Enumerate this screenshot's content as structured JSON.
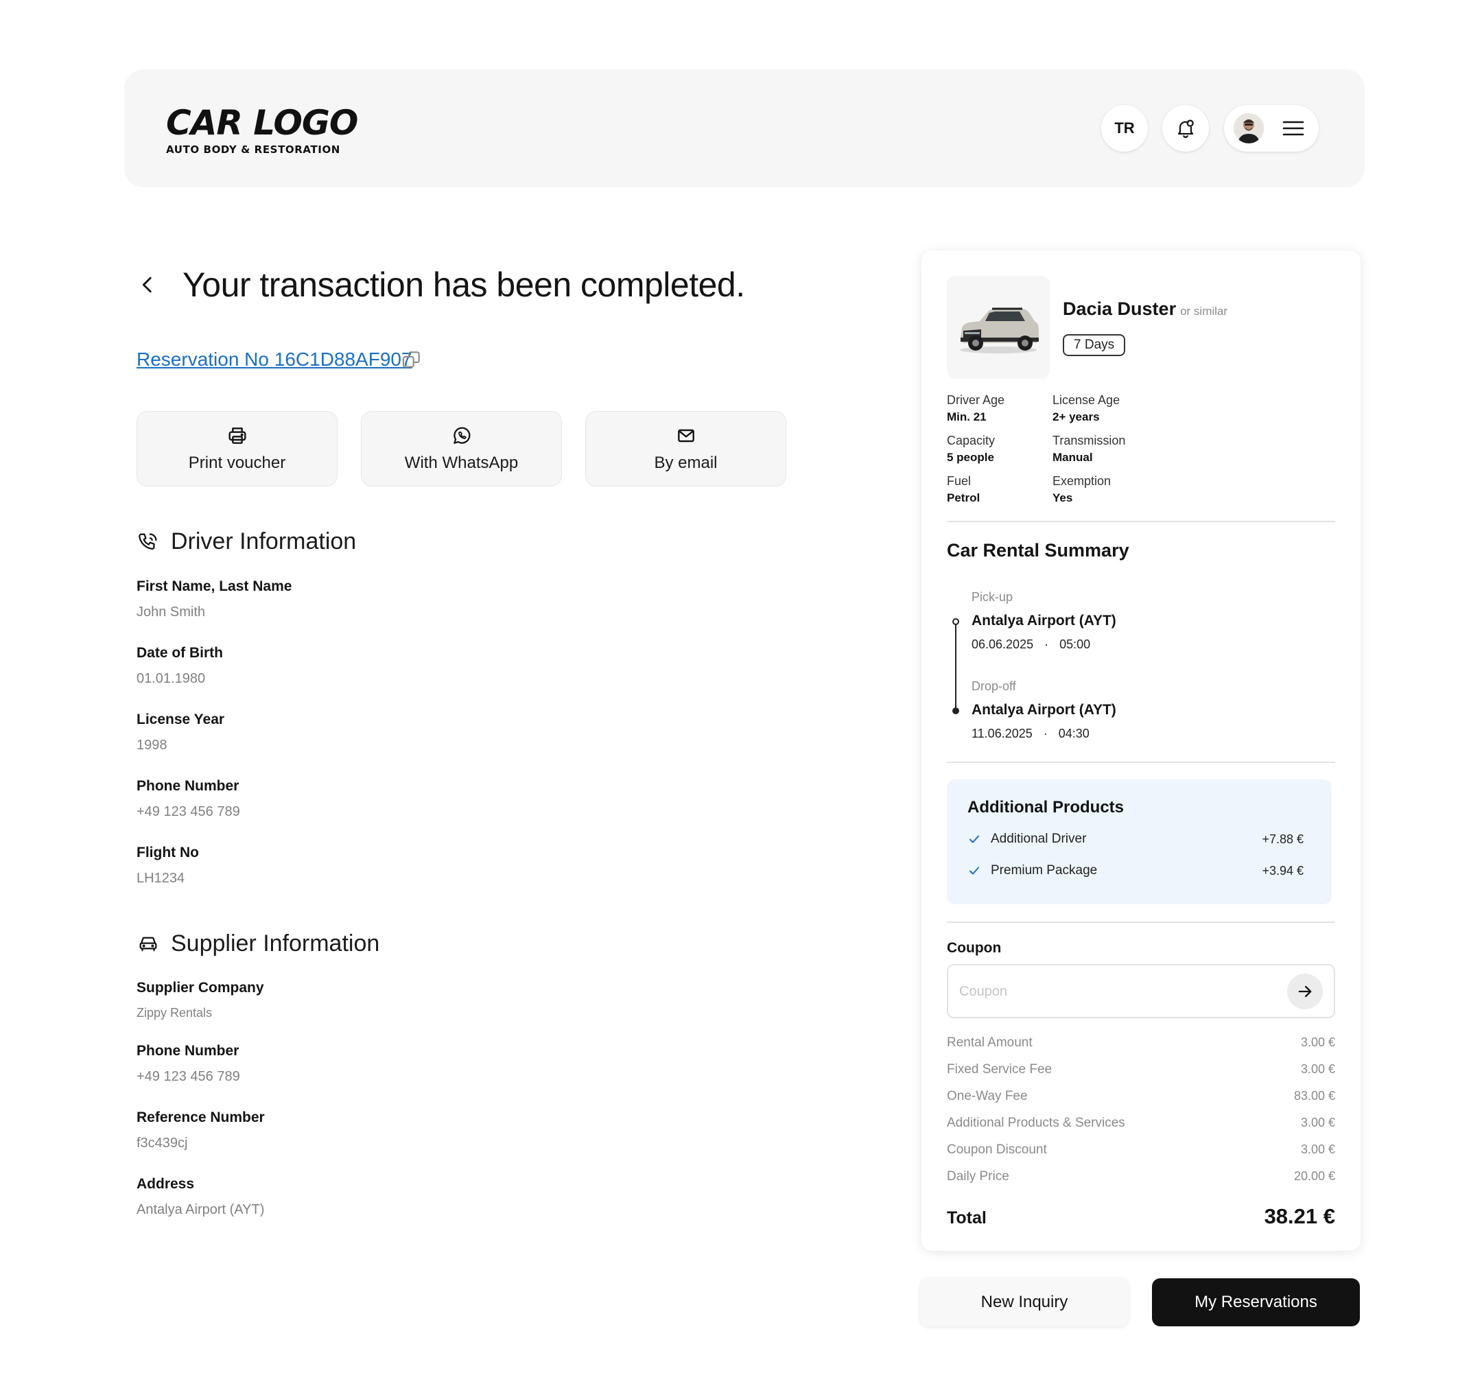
{
  "header": {
    "logo_main": "CAR LOGO",
    "logo_sub": "AUTO BODY & RESTORATION",
    "lang_label": "TR"
  },
  "main": {
    "title": "Your transaction has been completed.",
    "reservation_link": "Reservation No 16C1D88AF907",
    "actions": {
      "print": "Print voucher",
      "whatsapp": "With WhatsApp",
      "email": "By email"
    }
  },
  "driver": {
    "heading": "Driver Information",
    "fields": [
      {
        "label": "First Name, Last Name",
        "value": "John Smith"
      },
      {
        "label": "Date of Birth",
        "value": "01.01.1980"
      },
      {
        "label": "License Year",
        "value": "1998"
      },
      {
        "label": "Phone Number",
        "value": "+49 123 456 789"
      },
      {
        "label": "Flight No",
        "value": "LH1234"
      }
    ]
  },
  "supplier": {
    "heading": "Supplier Information",
    "fields": [
      {
        "label": "Supplier Company",
        "value": "Zippy Rentals"
      },
      {
        "label": "Phone Number",
        "value": "+49 123 456 789"
      },
      {
        "label": "Reference Number",
        "value": "f3c439cj"
      },
      {
        "label": "Address",
        "value": "Antalya Airport (AYT)"
      }
    ]
  },
  "car": {
    "name": "Dacia Duster",
    "similar": "or similar",
    "duration": "7 Days",
    "specs": [
      {
        "label": "Driver Age",
        "value": "Min. 21"
      },
      {
        "label": "License Age",
        "value": "2+ years"
      },
      {
        "label": "Capacity",
        "value": "5 people"
      },
      {
        "label": "Transmission",
        "value": "Manual"
      },
      {
        "label": "Fuel",
        "value": "Petrol"
      },
      {
        "label": "Exemption",
        "value": "Yes"
      }
    ]
  },
  "summary": {
    "heading": "Car Rental Summary",
    "pickup": {
      "label": "Pick-up",
      "location": "Antalya Airport (AYT)",
      "date": "06.06.2025",
      "separator": "·",
      "time": "05:00"
    },
    "dropoff": {
      "label": "Drop-off",
      "location": "Antalya Airport (AYT)",
      "date": "11.06.2025",
      "separator": "·",
      "time": "04:30"
    }
  },
  "additional": {
    "heading": "Additional Products",
    "items": [
      {
        "name": "Additional Driver",
        "price": "+7.88 €"
      },
      {
        "name": "Premium Package",
        "price": "+3.94 €"
      }
    ]
  },
  "coupon": {
    "label": "Coupon",
    "placeholder": "Coupon",
    "value": ""
  },
  "prices": [
    {
      "label": "Rental Amount",
      "value": "3.00 €"
    },
    {
      "label": "Fixed Service Fee",
      "value": "3.00 €"
    },
    {
      "label": "One-Way Fee",
      "value": "83.00 €"
    },
    {
      "label": "Additional Products & Services",
      "value": "3.00 €"
    },
    {
      "label": "Coupon Discount",
      "value": "3.00 €"
    },
    {
      "label": "Daily Price",
      "value": "20.00 €"
    }
  ],
  "total": {
    "label": "Total",
    "value": "38.21 €"
  },
  "buttons": {
    "new_inquiry": "New Inquiry",
    "my_reservations": "My Reservations"
  },
  "colors": {
    "link": "#1a6fc4",
    "check": "#1a6fc4",
    "additional_bg": "#eef5fc",
    "primary_button": "#121212"
  }
}
